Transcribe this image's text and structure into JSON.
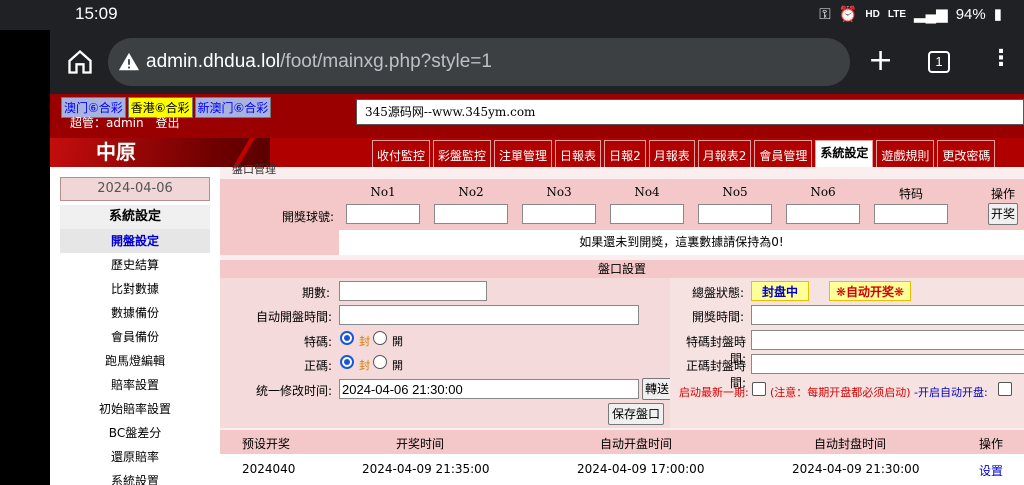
{
  "status_bar": {
    "time": "15:09",
    "network": "LTE",
    "hd": "HD",
    "battery": "94%"
  },
  "browser": {
    "url_host": "admin.dhdua.lol",
    "url_path": "/foot/mainxg.php?style=1",
    "tab_count": "1"
  },
  "header": {
    "lottery_links": [
      "澳门⑥合彩",
      "香港⑥合彩",
      "新澳门⑥合彩"
    ],
    "active_lottery_index": 1,
    "admin_label": "超管：admin",
    "logout": "登出",
    "notice": "345源码网--www.345ym.com"
  },
  "nav": {
    "brand": "中原",
    "tabs": [
      "收付監控",
      "彩盤監控",
      "注單管理",
      "日報表",
      "日報2",
      "月報表",
      "月報表2",
      "會員管理",
      "系統設定",
      "遊戲規則",
      "更改密碼"
    ],
    "active_tab": "系統設定"
  },
  "sidebar": {
    "date": "2024-04-06",
    "header": "系統設定",
    "items": [
      "開盤設定",
      "歷史結算",
      "比對數據",
      "數據備份",
      "會員備份",
      "跑馬燈編輯",
      "賠率設置",
      "初始賠率設置",
      "BC盤差分",
      "還原賠率",
      "系統設置"
    ],
    "selected": "開盤設定"
  },
  "draw": {
    "section_title": "盤口管理",
    "columns": [
      "No1",
      "No2",
      "No3",
      "No4",
      "No5",
      "No6",
      "特码",
      "操作"
    ],
    "row_label": "開獎球號:",
    "draw_button": "开奖",
    "note": "如果還未到開獎，這裏數據請保持為0!"
  },
  "settings": {
    "title": "盤口設置",
    "period_label": "期數:",
    "period_value": "",
    "auto_open_label": "自动開盤時間:",
    "auto_open_value": "",
    "special_label": "特碼:",
    "regular_label": "正碼:",
    "radio_close": "封",
    "radio_open": "開",
    "unified_label": "统一修改时间:",
    "unified_value": "2024-04-06 21:30:00",
    "send_button": "轉送",
    "save_button": "保存盤口",
    "status_label": "總盤狀態:",
    "status_value": "封盘中",
    "auto_draw": "❋自动开奖❋",
    "draw_time_label": "開獎時間:",
    "special_close_label": "特碼封盤時間:",
    "regular_close_label": "正碼封盤時間:",
    "auto_latest_label": "启动最新一期:",
    "auto_latest_note": "(注意：每期开盘都必须启动)",
    "auto_open_draw_label": "-开启自动开盘:"
  },
  "list": {
    "headers": [
      "预设开奖",
      "开奖时间",
      "自动开盘时间",
      "自动封盘时间",
      "操作"
    ],
    "rows": [
      {
        "period": "2024040",
        "draw_time": "2024-04-09 21:35:00",
        "open_time": "2024-04-09 17:00:00",
        "close_time": "2024-04-09 21:30:00",
        "action": "设置"
      }
    ]
  },
  "colors": {
    "brand_red": "#9a0000",
    "panel_pink": "#f4c8c8",
    "highlight_yellow": "#ffff99",
    "warning_red": "#d40000"
  }
}
